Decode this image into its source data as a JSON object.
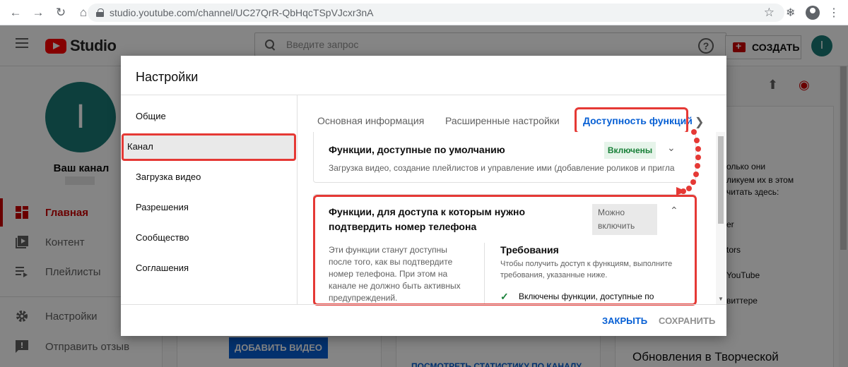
{
  "browser": {
    "url": "studio.youtube.com/channel/UC27QrR-QbHqcTSpVJcxr3nA"
  },
  "header": {
    "logo_text": "Studio",
    "search_placeholder": "Введите запрос",
    "create_label": "СОЗДАТЬ",
    "avatar_letter": "I"
  },
  "sidebar": {
    "avatar_letter": "I",
    "channel_label": "Ваш канал",
    "items": [
      {
        "label": "Главная",
        "icon": "dashboard-icon",
        "active": true
      },
      {
        "label": "Контент",
        "icon": "content-icon",
        "active": false
      },
      {
        "label": "Плейлисты",
        "icon": "playlists-icon",
        "active": false
      },
      {
        "label": "Настройки",
        "icon": "gear-icon",
        "active": false
      },
      {
        "label": "Отправить отзыв",
        "icon": "feedback-icon",
        "active": false
      }
    ]
  },
  "background": {
    "upload_button": "ДОБАВИТЬ ВИДЕО",
    "updates_title": "Обновления в Творческой",
    "stats_link": "ПОСМОТРЕТЬ СТАТИСТИКУ ПО КАНАЛУ",
    "right_peek": [
      "олько они",
      "ликуем их в этом",
      "читать здесь:",
      "er",
      "tors",
      "YouTube",
      "виттере"
    ]
  },
  "dialog": {
    "title": "Настройки",
    "nav": [
      "Общие",
      "Канал",
      "Загрузка видео",
      "Разрешения",
      "Сообщество",
      "Соглашения"
    ],
    "tabs": [
      "Основная информация",
      "Расширенные настройки",
      "Доступность функций"
    ],
    "card_default": {
      "title": "Функции, доступные по умолчанию",
      "status": "Включены",
      "description": "Загрузка видео, создание плейлистов и управление ими (добавление роликов и приглаш..."
    },
    "card_phone": {
      "title": "Функции, для доступа к которым нужно подтвердить номер телефона",
      "status": "Можно включить",
      "left_text": "Эти функции станут доступны после того, как вы подтвердите номер телефона. При этом на канале не должно быть активных предупреждений.",
      "requirements_title": "Требования",
      "requirements_desc": "Чтобы получить доступ к функциям, выполните требования, указанные ниже.",
      "requirement_item": "Включены функции, доступные по"
    },
    "close_label": "ЗАКРЫТЬ",
    "save_label": "СОХРАНИТЬ"
  },
  "colors": {
    "accent_blue": "#065fd4",
    "highlight_red": "#e53935",
    "enabled_green": "#188038",
    "brand_red": "#ff0000"
  }
}
